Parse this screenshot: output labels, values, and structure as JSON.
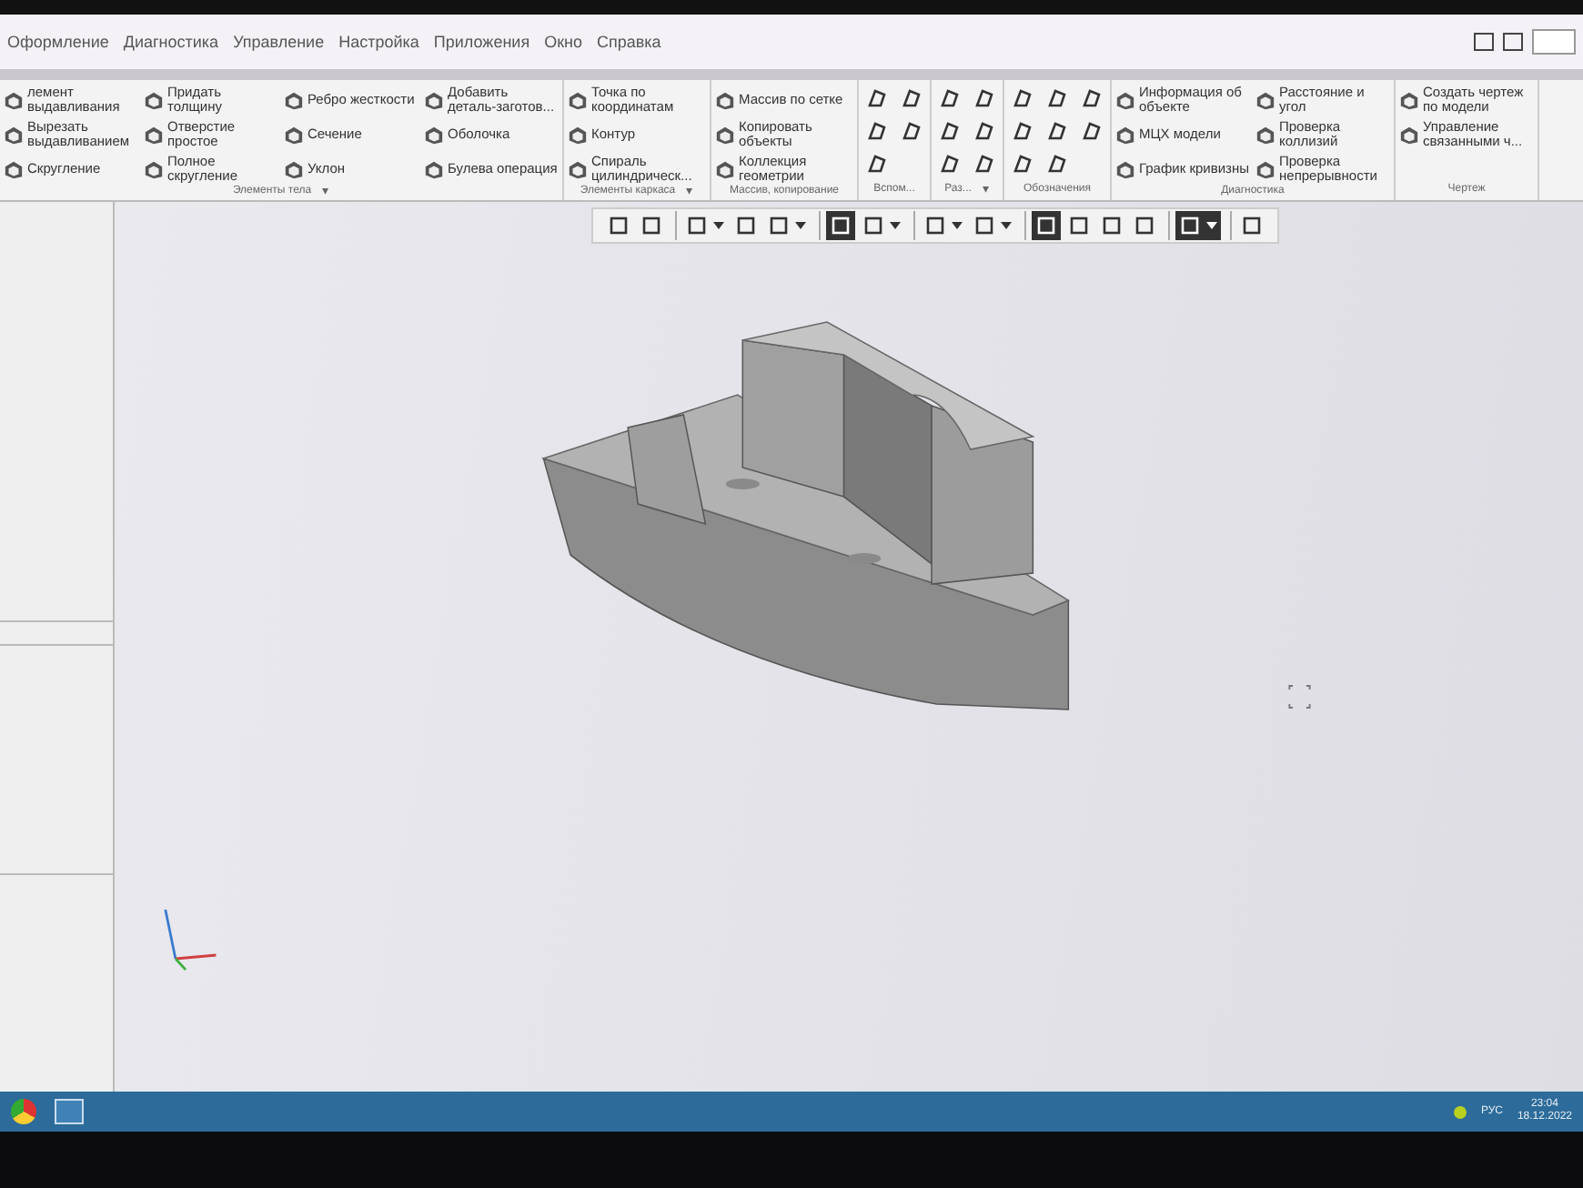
{
  "menu": [
    {
      "label": "Оформление"
    },
    {
      "label": "Диагностика"
    },
    {
      "label": "Управление"
    },
    {
      "label": "Настройка"
    },
    {
      "label": "Приложения"
    },
    {
      "label": "Окно"
    },
    {
      "label": "Справка"
    }
  ],
  "ribbon": {
    "groups": [
      {
        "title": "Элементы тела",
        "menu_arrow": "▾",
        "columns": [
          [
            {
              "kind": "tool",
              "label": "лемент выдавливания"
            },
            {
              "kind": "tool",
              "label": "Вырезать выдавливанием"
            },
            {
              "kind": "tool",
              "label": "Скругление"
            }
          ],
          [
            {
              "kind": "tool",
              "label": "Придать толщину"
            },
            {
              "kind": "tool",
              "label": "Отверстие простое"
            },
            {
              "kind": "tool",
              "label": "Полное скругление"
            }
          ],
          [
            {
              "kind": "tool",
              "label": "Ребро жесткости"
            },
            {
              "kind": "tool",
              "label": "Сечение"
            },
            {
              "kind": "tool",
              "label": "Уклон"
            }
          ],
          [
            {
              "kind": "tool",
              "label": "Добавить деталь-заготов..."
            },
            {
              "kind": "tool",
              "label": "Оболочка"
            },
            {
              "kind": "tool",
              "label": "Булева операция"
            }
          ]
        ]
      },
      {
        "title": "Элементы каркаса",
        "menu_arrow": "▾",
        "columns": [
          [
            {
              "kind": "tool",
              "label": "Точка по координатам"
            },
            {
              "kind": "tool",
              "label": "Контур"
            },
            {
              "kind": "tool",
              "label": "Спираль цилиндрическ..."
            }
          ]
        ]
      },
      {
        "title": "Массив, копирование",
        "columns": [
          [
            {
              "kind": "tool",
              "label": "Массив по сетке"
            },
            {
              "kind": "tool",
              "label": "Копировать объекты"
            },
            {
              "kind": "tool",
              "label": "Коллекция геометрии"
            }
          ]
        ]
      },
      {
        "title": "Вспом...",
        "columns": [
          [
            {
              "kind": "icon"
            },
            {
              "kind": "icon"
            },
            {
              "kind": "icon"
            }
          ],
          [
            {
              "kind": "icon"
            },
            {
              "kind": "icon"
            }
          ]
        ]
      },
      {
        "title": "Раз...",
        "menu_arrow": "▾",
        "columns": [
          [
            {
              "kind": "icon"
            },
            {
              "kind": "icon"
            },
            {
              "kind": "icon"
            }
          ],
          [
            {
              "kind": "icon"
            },
            {
              "kind": "icon"
            },
            {
              "kind": "icon"
            }
          ]
        ]
      },
      {
        "title": "Обозначения",
        "columns": [
          [
            {
              "kind": "icon"
            },
            {
              "kind": "icon"
            },
            {
              "kind": "icon"
            }
          ],
          [
            {
              "kind": "icon"
            },
            {
              "kind": "icon"
            },
            {
              "kind": "icon"
            }
          ],
          [
            {
              "kind": "icon"
            },
            {
              "kind": "icon"
            }
          ]
        ]
      },
      {
        "title": "Диагностика",
        "columns": [
          [
            {
              "kind": "tool",
              "label": "Информация об объекте"
            },
            {
              "kind": "tool",
              "label": "МЦХ модели"
            },
            {
              "kind": "tool",
              "label": "График кривизны"
            }
          ],
          [
            {
              "kind": "tool",
              "label": "Расстояние и угол"
            },
            {
              "kind": "tool",
              "label": "Проверка коллизий"
            },
            {
              "kind": "tool",
              "label": "Проверка непрерывности"
            }
          ]
        ]
      },
      {
        "title": "Чертеж",
        "columns": [
          [
            {
              "kind": "tool",
              "label": "Создать чертеж по модели"
            },
            {
              "kind": "tool",
              "label": "Управление связанными ч..."
            }
          ]
        ]
      }
    ]
  },
  "view_toolbar": {
    "groups": [
      {
        "buttons": [
          {
            "dropdown": false,
            "selected": false
          },
          {
            "dropdown": false,
            "selected": false
          }
        ]
      },
      {
        "buttons": [
          {
            "dropdown": true,
            "selected": false
          },
          {
            "dropdown": false,
            "selected": false
          },
          {
            "dropdown": true,
            "selected": false
          }
        ]
      },
      {
        "buttons": [
          {
            "dropdown": false,
            "selected": true
          },
          {
            "dropdown": true,
            "selected": false
          }
        ]
      },
      {
        "buttons": [
          {
            "dropdown": true,
            "selected": false
          },
          {
            "dropdown": true,
            "selected": false
          }
        ]
      },
      {
        "buttons": [
          {
            "dropdown": false,
            "selected": true
          },
          {
            "dropdown": false,
            "selected": false
          },
          {
            "dropdown": false,
            "selected": false
          },
          {
            "dropdown": false,
            "selected": false
          }
        ]
      },
      {
        "buttons": [
          {
            "dropdown": true,
            "selected": true
          }
        ]
      },
      {
        "buttons": [
          {
            "dropdown": false,
            "selected": false
          }
        ]
      }
    ]
  },
  "taskbar": {
    "language": "РУС",
    "time": "23:04",
    "date": "18.12.2022"
  }
}
